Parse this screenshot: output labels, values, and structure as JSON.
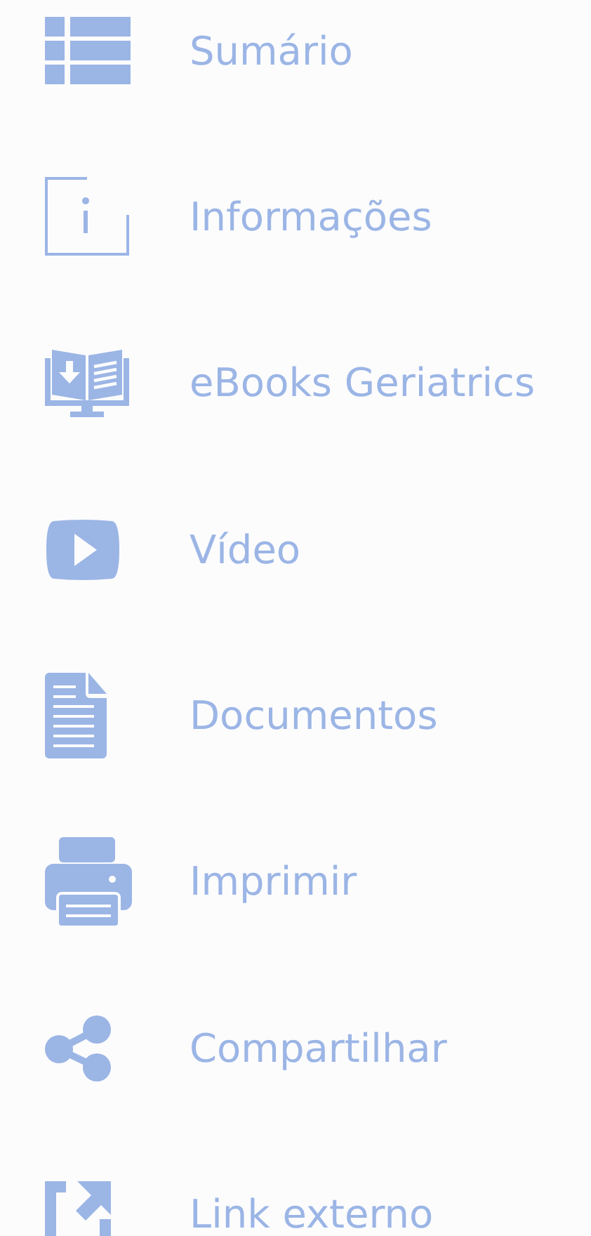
{
  "menu": [
    {
      "kind": "toc",
      "label": "Sumário"
    },
    {
      "kind": "info",
      "label": "Informações"
    },
    {
      "kind": "ebook",
      "label": "eBooks Geriatrics"
    },
    {
      "kind": "video",
      "label": "Vídeo"
    },
    {
      "kind": "document",
      "label": "Documentos"
    },
    {
      "kind": "print",
      "label": "Imprimir"
    },
    {
      "kind": "share",
      "label": "Compartilhar"
    },
    {
      "kind": "external",
      "label": "Link externo"
    }
  ]
}
